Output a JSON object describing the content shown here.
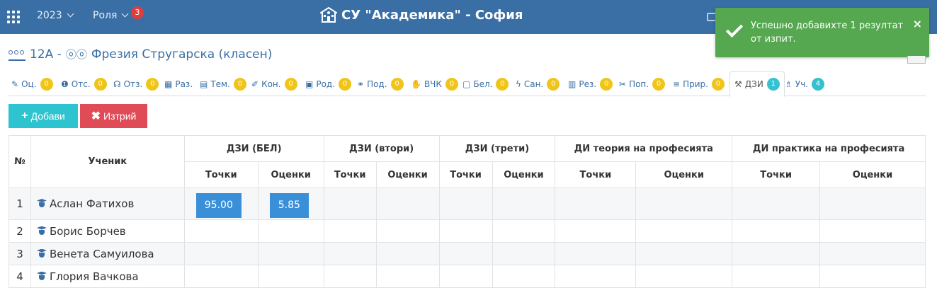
{
  "topbar": {
    "year": "2023",
    "role": "Роля",
    "role_badge": "3",
    "school": "СУ \"Академика\" - София"
  },
  "toast": {
    "message": "Успешно добавихте 1 резултат от изпит.",
    "close": "×"
  },
  "heading": {
    "class": "12А -",
    "teacher": "Фрезия Стругарска (класен)"
  },
  "tabs": [
    {
      "icon": "✎",
      "label": "Оц.",
      "badge": "0"
    },
    {
      "icon": "❶",
      "label": "Отс.",
      "badge": "0"
    },
    {
      "icon": "☊",
      "label": "Отз.",
      "badge": "0"
    },
    {
      "icon": "▦",
      "label": "Раз.",
      "badge": ""
    },
    {
      "icon": "▤",
      "label": "Тем.",
      "badge": "0"
    },
    {
      "icon": "✐",
      "label": "Кон.",
      "badge": "0"
    },
    {
      "icon": "▣",
      "label": "Род.",
      "badge": "0"
    },
    {
      "icon": "⚭",
      "label": "Под.",
      "badge": "0"
    },
    {
      "icon": "✋",
      "label": "ВЧК",
      "badge": "0"
    },
    {
      "icon": "▢",
      "label": "Бел.",
      "badge": "0"
    },
    {
      "icon": "ϟ",
      "label": "Сан.",
      "badge": "0"
    },
    {
      "icon": "▥",
      "label": "Рез.",
      "badge": "0"
    },
    {
      "icon": "✂",
      "label": "Поп.",
      "badge": "0"
    },
    {
      "icon": "≡",
      "label": "Прир.",
      "badge": "0"
    },
    {
      "icon": "⚒",
      "label": "ДЗИ",
      "badge": "1"
    },
    {
      "icon": "♗",
      "label": "Уч.",
      "badge": "4"
    }
  ],
  "buttons": {
    "add": "Добави",
    "delete": "Изтрий"
  },
  "table": {
    "col_num": "№",
    "col_student": "Ученик",
    "groups": [
      "ДЗИ (БЕЛ)",
      "ДЗИ (втори)",
      "ДЗИ (трети)",
      "ДИ теория на професията",
      "ДИ практика на професията"
    ],
    "sub_points": "Точки",
    "sub_grades": "Оценки",
    "rows": [
      {
        "num": "1",
        "name": "Аслан Фатихов",
        "points": "95.00",
        "grade": "5.85"
      },
      {
        "num": "2",
        "name": "Борис Борчев",
        "points": "",
        "grade": ""
      },
      {
        "num": "3",
        "name": "Венета Самуилова",
        "points": "",
        "grade": ""
      },
      {
        "num": "4",
        "name": "Глория Вачкова",
        "points": "",
        "grade": ""
      }
    ]
  }
}
